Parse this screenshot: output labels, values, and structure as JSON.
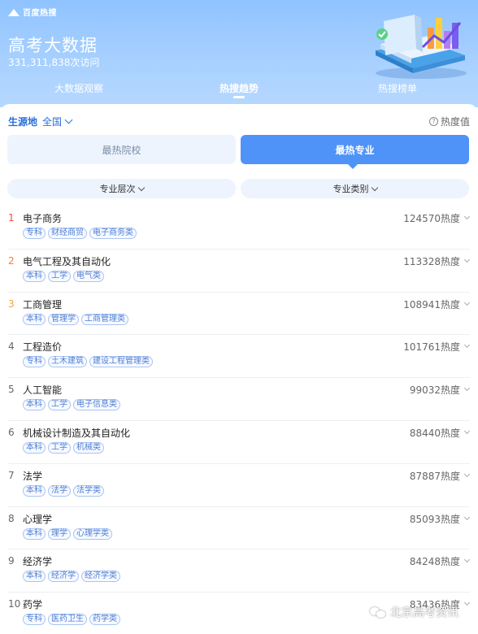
{
  "brand": {
    "name": "百度热搜"
  },
  "header": {
    "title": "高考大数据",
    "visits": "331,311,838次访问",
    "tabs": [
      {
        "label": "大数据观察",
        "active": false
      },
      {
        "label": "热搜趋势",
        "active": true
      },
      {
        "label": "热搜榜单",
        "active": false
      }
    ]
  },
  "filters": {
    "origin_label": "生源地",
    "origin_value": "全国",
    "heat_help": "热度值",
    "segments": [
      {
        "label": "最热院校",
        "active": false
      },
      {
        "label": "最热专业",
        "active": true
      }
    ],
    "dropdowns": [
      {
        "label": "专业层次"
      },
      {
        "label": "专业类别"
      }
    ]
  },
  "majors": [
    {
      "rank": "1",
      "name": "电子商务",
      "heat": "124570热度",
      "tags": [
        "专科",
        "财经商贸",
        "电子商务类"
      ]
    },
    {
      "rank": "2",
      "name": "电气工程及其自动化",
      "heat": "113328热度",
      "tags": [
        "本科",
        "工学",
        "电气类"
      ]
    },
    {
      "rank": "3",
      "name": "工商管理",
      "heat": "108941热度",
      "tags": [
        "本科",
        "管理学",
        "工商管理类"
      ]
    },
    {
      "rank": "4",
      "name": "工程造价",
      "heat": "101761热度",
      "tags": [
        "专科",
        "土木建筑",
        "建设工程管理类"
      ]
    },
    {
      "rank": "5",
      "name": "人工智能",
      "heat": "99032热度",
      "tags": [
        "本科",
        "工学",
        "电子信息类"
      ]
    },
    {
      "rank": "6",
      "name": "机械设计制造及其自动化",
      "heat": "88440热度",
      "tags": [
        "本科",
        "工学",
        "机械类"
      ]
    },
    {
      "rank": "7",
      "name": "法学",
      "heat": "87887热度",
      "tags": [
        "本科",
        "法学",
        "法学类"
      ]
    },
    {
      "rank": "8",
      "name": "心理学",
      "heat": "85093热度",
      "tags": [
        "本科",
        "理学",
        "心理学类"
      ]
    },
    {
      "rank": "9",
      "name": "经济学",
      "heat": "84248热度",
      "tags": [
        "本科",
        "经济学",
        "经济学类"
      ]
    },
    {
      "rank": "10",
      "name": "药学",
      "heat": "83436热度",
      "tags": [
        "专科",
        "医药卫生",
        "药学类"
      ]
    }
  ],
  "watermark": {
    "text": "北京高考资讯"
  },
  "colors": {
    "accent": "#4f93f9",
    "header_bg": "#a9d1ff",
    "rank1": "#f0533d",
    "rank2": "#f0803d",
    "rank3": "#f3a43b"
  }
}
